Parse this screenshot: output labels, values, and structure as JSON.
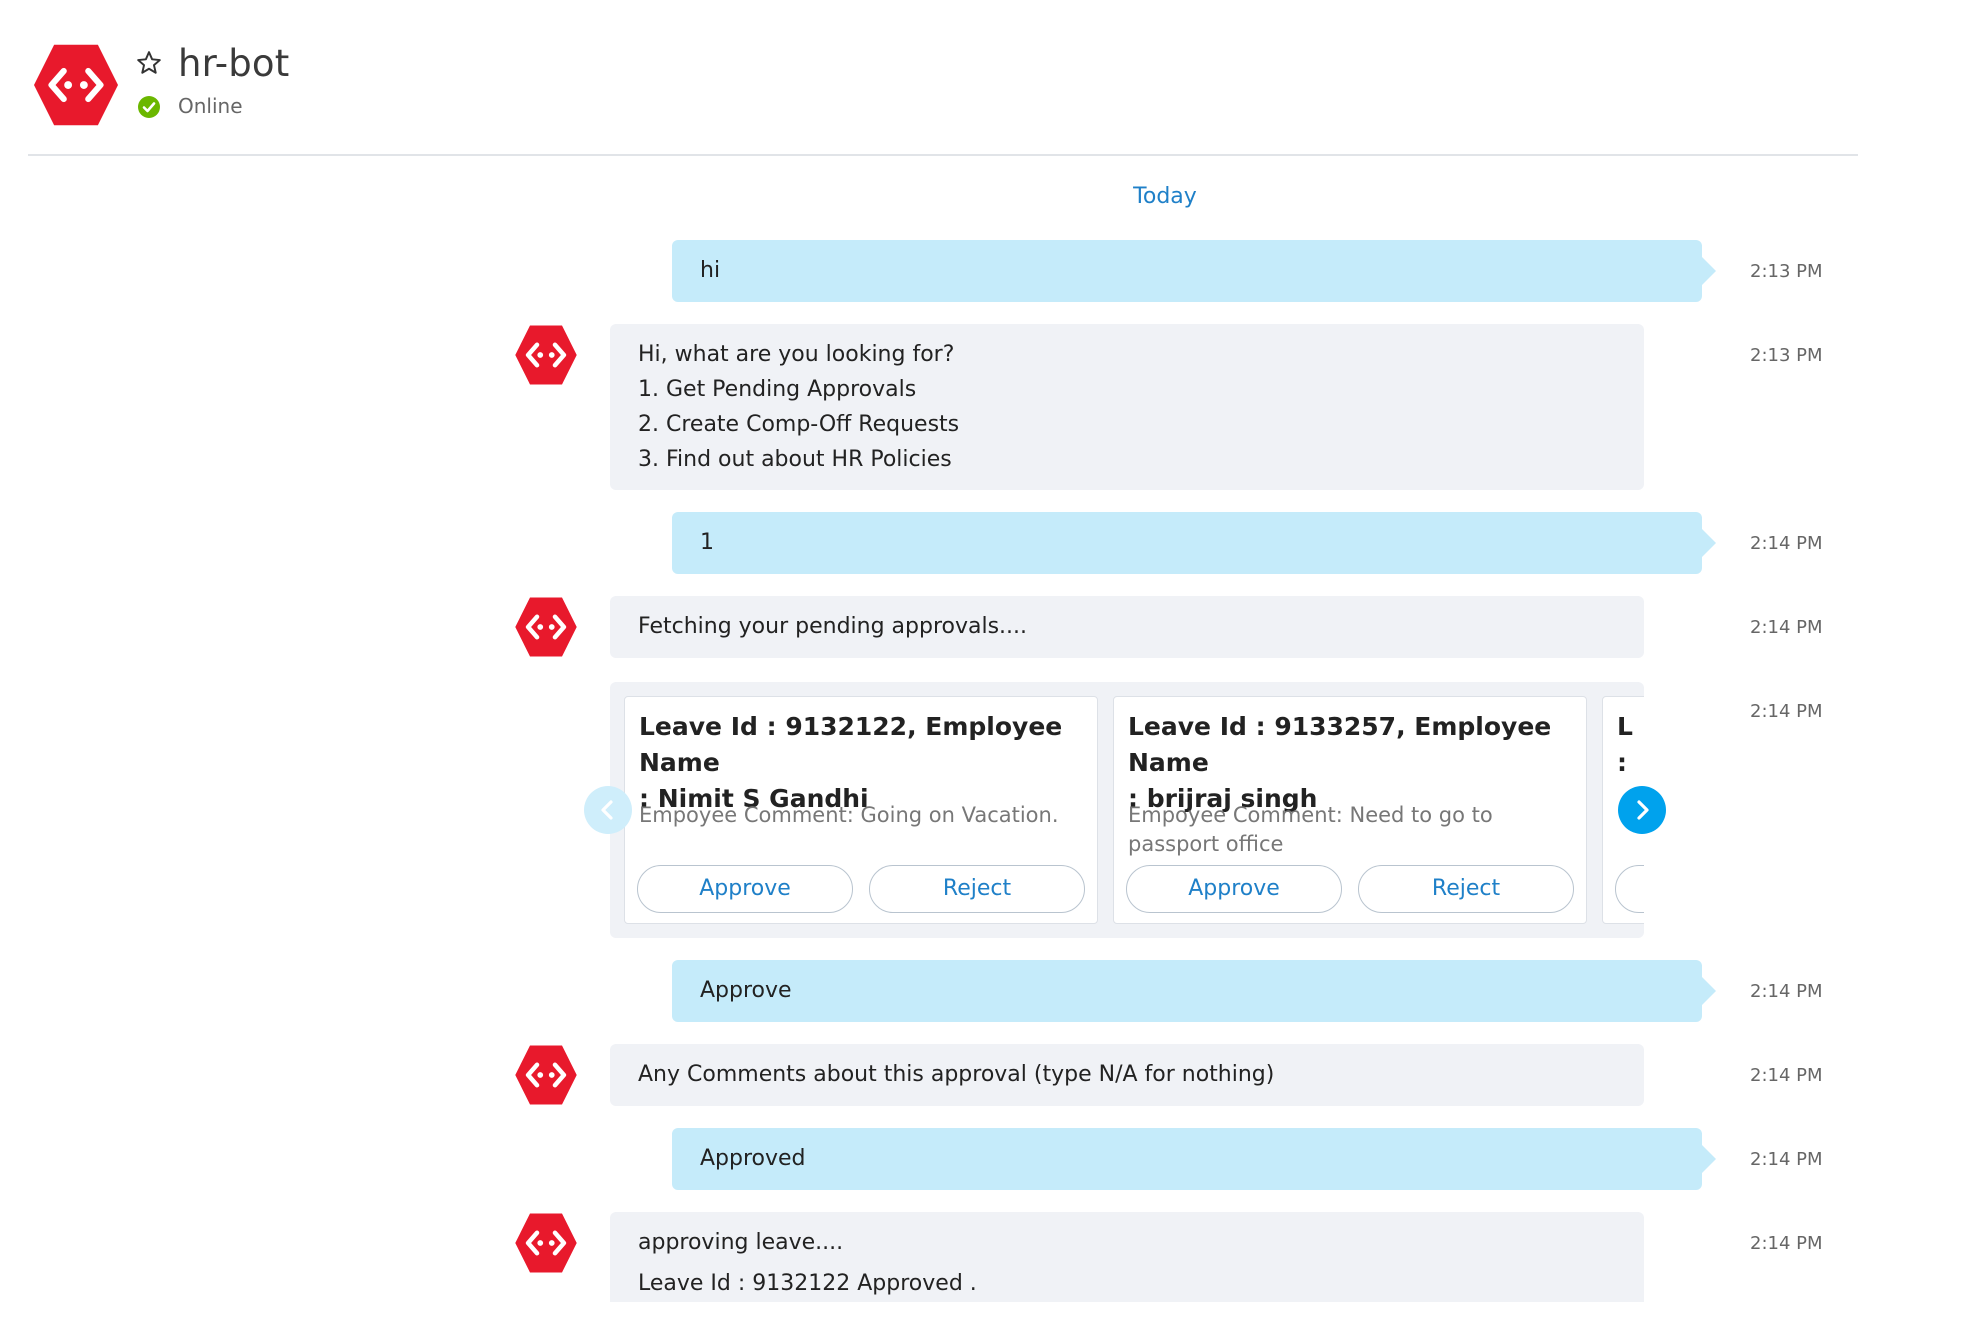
{
  "header": {
    "bot_name": "hr-bot",
    "status": "Online"
  },
  "colors": {
    "brand_red": "#e8192c",
    "outgoing_bubble": "#c5ebfa",
    "incoming_bubble": "#f0f2f6",
    "accent_blue": "#1f80c8",
    "online_green": "#6bb700"
  },
  "day_separator": "Today",
  "messages": [
    {
      "direction": "out",
      "text": "hi",
      "time": "2:13 PM"
    },
    {
      "direction": "in",
      "lines": [
        "Hi, what are you looking for?",
        "1. Get Pending Approvals",
        "2. Create Comp-Off Requests",
        "3. Find out about HR Policies"
      ],
      "time": "2:13 PM"
    },
    {
      "direction": "out",
      "text": "1",
      "time": "2:14 PM"
    },
    {
      "direction": "in",
      "text": "Fetching your pending approvals....",
      "time": "2:14 PM"
    },
    {
      "direction": "in",
      "type": "carousel",
      "time": "2:14 PM"
    },
    {
      "direction": "out",
      "text": "Approve",
      "time": "2:14 PM"
    },
    {
      "direction": "in",
      "text": "Any Comments about this approval (type N/A for nothing)",
      "time": "2:14 PM"
    },
    {
      "direction": "out",
      "text": "Approved",
      "time": "2:14 PM"
    },
    {
      "direction": "in",
      "lines": [
        "approving leave....",
        "Leave Id : 9132122 Approved ."
      ],
      "time": "2:14 PM"
    }
  ],
  "carousel": {
    "cards": [
      {
        "title_line1": "Leave Id : 9132122, Employee Name",
        "title_line2": ": Nimit S Gandhi",
        "comment_line1": "Empoyee Comment: Going on Vacation.",
        "comment_line2": "",
        "approve_label": "Approve",
        "reject_label": "Reject"
      },
      {
        "title_line1": "Leave Id : 9133257, Employee Name",
        "title_line2": ": brijraj singh",
        "comment_line1": "Empoyee Comment: Need to go to",
        "comment_line2": "passport office",
        "approve_label": "Approve",
        "reject_label": "Reject"
      }
    ],
    "partial_card_letters": [
      "L",
      ":"
    ],
    "prev_icon": "chevron-left-icon",
    "next_icon": "chevron-right-icon"
  }
}
